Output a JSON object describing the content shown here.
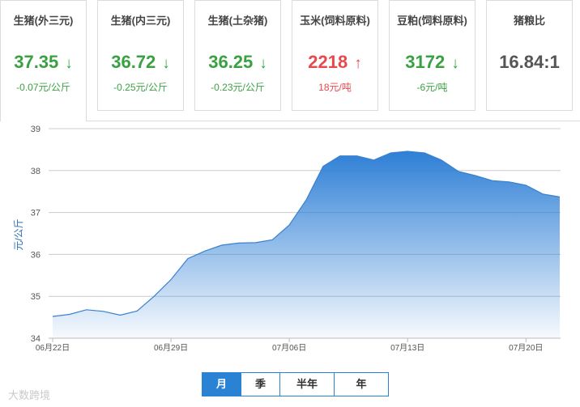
{
  "cards": [
    {
      "title": "生猪(外三元)",
      "price": "37.35",
      "arrow": "↓",
      "change": "-0.07元/公斤",
      "trend": "down"
    },
    {
      "title": "生猪(内三元)",
      "price": "36.72",
      "arrow": "↓",
      "change": "-0.25元/公斤",
      "trend": "down"
    },
    {
      "title": "生猪(土杂猪)",
      "price": "36.25",
      "arrow": "↓",
      "change": "-0.23元/公斤",
      "trend": "down"
    },
    {
      "title": "玉米(饲料原料)",
      "price": "2218",
      "arrow": "↑",
      "change": "18元/吨",
      "trend": "up"
    },
    {
      "title": "豆粕(饲料原料)",
      "price": "3172",
      "arrow": "↓",
      "change": "-6元/吨",
      "trend": "down"
    },
    {
      "title": "猪粮比",
      "price": "16.84:1",
      "arrow": "",
      "change": "",
      "trend": "neutral"
    }
  ],
  "period_buttons": [
    "月",
    "季",
    "半年",
    "年"
  ],
  "watermark": "大数跨境",
  "chart_data": {
    "type": "area",
    "ylabel": "元/公斤",
    "ylim": [
      34,
      39
    ],
    "yticks": [
      34,
      35,
      36,
      37,
      38,
      39
    ],
    "grid": true,
    "fill_color": "#2e7fd6",
    "line_color": "#3a80d0",
    "x_tick_labels": [
      "06月22日",
      "06月29日",
      "07月06日",
      "07月13日",
      "07月20日"
    ],
    "x": [
      "06-22",
      "06-23",
      "06-24",
      "06-25",
      "06-26",
      "06-27",
      "06-28",
      "06-29",
      "06-30",
      "07-01",
      "07-02",
      "07-03",
      "07-04",
      "07-05",
      "07-06",
      "07-07",
      "07-08",
      "07-09",
      "07-10",
      "07-11",
      "07-12",
      "07-13",
      "07-14",
      "07-15",
      "07-16",
      "07-17",
      "07-18",
      "07-19",
      "07-20",
      "07-21",
      "07-22"
    ],
    "values": [
      34.52,
      34.57,
      34.68,
      34.64,
      34.55,
      34.65,
      35.0,
      35.4,
      35.9,
      36.08,
      36.22,
      36.27,
      36.28,
      36.35,
      36.7,
      37.3,
      38.1,
      38.35,
      38.35,
      38.25,
      38.42,
      38.46,
      38.42,
      38.25,
      37.98,
      37.88,
      37.76,
      37.73,
      37.65,
      37.44,
      37.37
    ]
  }
}
